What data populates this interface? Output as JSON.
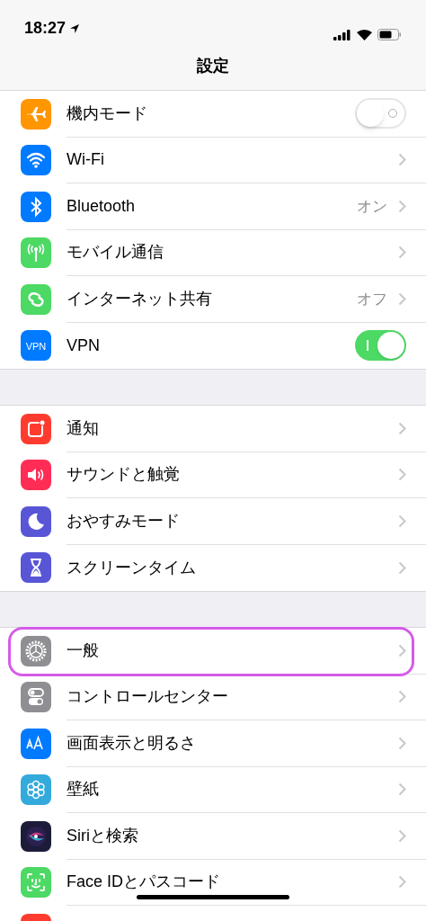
{
  "status_bar": {
    "time": "18:27"
  },
  "nav": {
    "title": "設定"
  },
  "groups": [
    {
      "items": [
        {
          "label": "機内モード",
          "kind": "toggle",
          "on": false
        },
        {
          "label": "Wi-Fi",
          "kind": "link"
        },
        {
          "label": "Bluetooth",
          "kind": "link",
          "value": "オン"
        },
        {
          "label": "モバイル通信",
          "kind": "link"
        },
        {
          "label": "インターネット共有",
          "kind": "link",
          "value": "オフ"
        },
        {
          "label": "VPN",
          "icon_text": "VPN",
          "kind": "toggle",
          "on": true
        }
      ]
    },
    {
      "items": [
        {
          "label": "通知",
          "kind": "link"
        },
        {
          "label": "サウンドと触覚",
          "kind": "link"
        },
        {
          "label": "おやすみモード",
          "kind": "link"
        },
        {
          "label": "スクリーンタイム",
          "kind": "link"
        }
      ]
    },
    {
      "items": [
        {
          "label": "一般",
          "kind": "link",
          "highlighted": true
        },
        {
          "label": "コントロールセンター",
          "kind": "link",
          "highlighted": false
        },
        {
          "label": "画面表示と明るさ",
          "kind": "link",
          "highlighted": false
        },
        {
          "label": "壁紙",
          "kind": "link",
          "highlighted": false
        },
        {
          "label": "Siriと検索",
          "kind": "link",
          "highlighted": false
        },
        {
          "label": "Face IDとパスコード",
          "kind": "link",
          "highlighted": false
        },
        {
          "kind": "partial",
          "highlighted": false
        }
      ]
    }
  ]
}
